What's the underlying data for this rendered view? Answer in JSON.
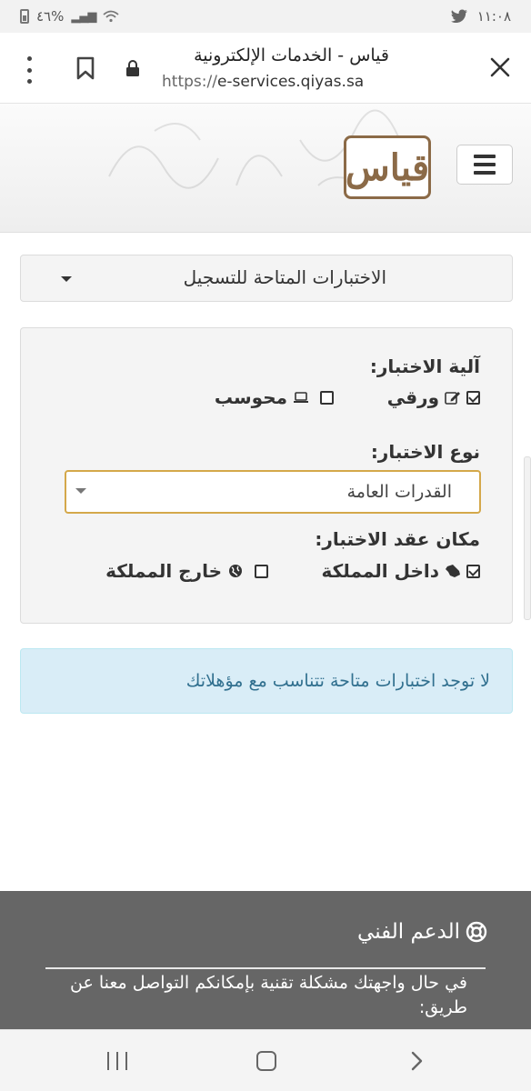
{
  "status_bar": {
    "time": "١١:٠٨",
    "battery_percent": "٤٦%"
  },
  "browser": {
    "title": "قياس - الخدمات الإلكترونية",
    "url_scheme": "https://",
    "url_host": "e-services.qiyas.sa"
  },
  "header": {
    "logo_text": "قياس"
  },
  "exams_dropdown": {
    "label": "الاختبارات المتاحة للتسجيل"
  },
  "filters": {
    "mechanism": {
      "label": "آلية الاختبار:",
      "options": [
        {
          "label": "ورقي",
          "checked": true,
          "icon": "pencil-square-icon"
        },
        {
          "label": "محوسب",
          "checked": false,
          "icon": "laptop-icon"
        }
      ]
    },
    "type": {
      "label": "نوع الاختبار:",
      "selected": "القدرات العامة"
    },
    "location": {
      "label": "مكان عقد الاختبار:",
      "options": [
        {
          "label": "داخل المملكة",
          "checked": true,
          "icon": "saudi-map-icon"
        },
        {
          "label": "خارج المملكة",
          "checked": false,
          "icon": "globe-icon"
        }
      ]
    }
  },
  "alert": {
    "text": "لا توجد اختبارات متاحة تتناسب مع مؤهلاتك"
  },
  "footer": {
    "support_title": "الدعم الفني",
    "support_text": "في حال واجهتك مشكلة تقنية بإمكانكم التواصل معنا عن طريق:"
  },
  "colors": {
    "brand_brown": "#8b6a47",
    "alert_bg": "#d9edf7",
    "alert_text": "#31708f",
    "footer_bg": "#666666",
    "select_focus": "#d4a84a"
  }
}
